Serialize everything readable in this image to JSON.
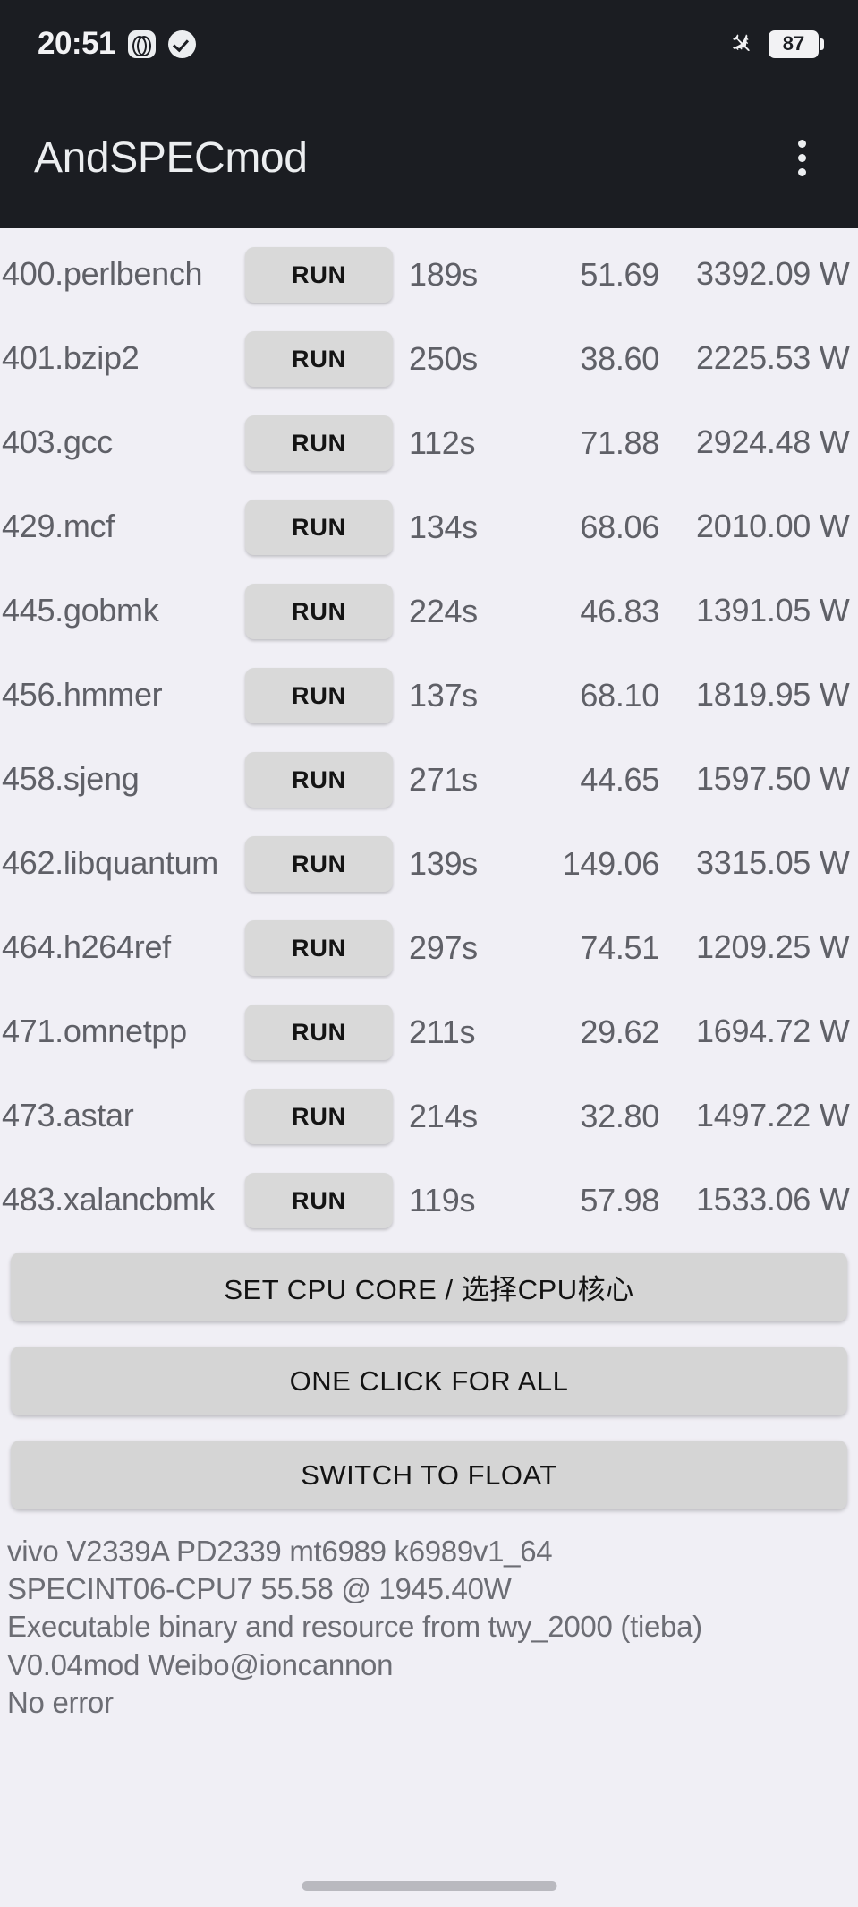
{
  "status_bar": {
    "time": "20:51",
    "dual_sim_icon": "dual-sim-icon",
    "check_icon": "check-circle-icon",
    "airplane_icon": "airplane-mode-icon",
    "battery_level": "87"
  },
  "app_bar": {
    "title": "AndSPECmod",
    "overflow_icon": "overflow-menu-icon"
  },
  "benchmarks": [
    {
      "name": "400.perlbench",
      "run_label": "RUN",
      "time": "189s",
      "score": "51.69",
      "power": "3392.09 W"
    },
    {
      "name": "401.bzip2",
      "run_label": "RUN",
      "time": "250s",
      "score": "38.60",
      "power": "2225.53 W"
    },
    {
      "name": "403.gcc",
      "run_label": "RUN",
      "time": "112s",
      "score": "71.88",
      "power": "2924.48 W"
    },
    {
      "name": "429.mcf",
      "run_label": "RUN",
      "time": "134s",
      "score": "68.06",
      "power": "2010.00 W"
    },
    {
      "name": "445.gobmk",
      "run_label": "RUN",
      "time": "224s",
      "score": "46.83",
      "power": "1391.05 W"
    },
    {
      "name": "456.hmmer",
      "run_label": "RUN",
      "time": "137s",
      "score": "68.10",
      "power": "1819.95 W"
    },
    {
      "name": "458.sjeng",
      "run_label": "RUN",
      "time": "271s",
      "score": "44.65",
      "power": "1597.50 W"
    },
    {
      "name": "462.libquantum",
      "run_label": "RUN",
      "time": "139s",
      "score": "149.06",
      "power": "3315.05 W"
    },
    {
      "name": "464.h264ref",
      "run_label": "RUN",
      "time": "297s",
      "score": "74.51",
      "power": "1209.25 W"
    },
    {
      "name": "471.omnetpp",
      "run_label": "RUN",
      "time": "211s",
      "score": "29.62",
      "power": "1694.72 W"
    },
    {
      "name": "473.astar",
      "run_label": "RUN",
      "time": "214s",
      "score": "32.80",
      "power": "1497.22 W"
    },
    {
      "name": "483.xalancbmk",
      "run_label": "RUN",
      "time": "119s",
      "score": "57.98",
      "power": "1533.06 W"
    }
  ],
  "actions": {
    "set_cpu_core": "SET CPU CORE / 选择CPU核心",
    "one_click_for_all": "ONE CLICK FOR ALL",
    "switch_to_float": "SWITCH TO FLOAT"
  },
  "footer": {
    "line1": "vivo V2339A PD2339 mt6989 k6989v1_64",
    "line2": "SPECINT06-CPU7  55.58 @ 1945.40W",
    "line3": "Executable binary and resource from twy_2000 (tieba)",
    "line4": "V0.04mod  Weibo@ioncannon",
    "line5": "No error"
  },
  "colors": {
    "app_bar_bg": "#1b1d22",
    "page_bg": "#f0eff5",
    "button_bg": "#d5d5d5",
    "text_muted": "#5f6067"
  }
}
